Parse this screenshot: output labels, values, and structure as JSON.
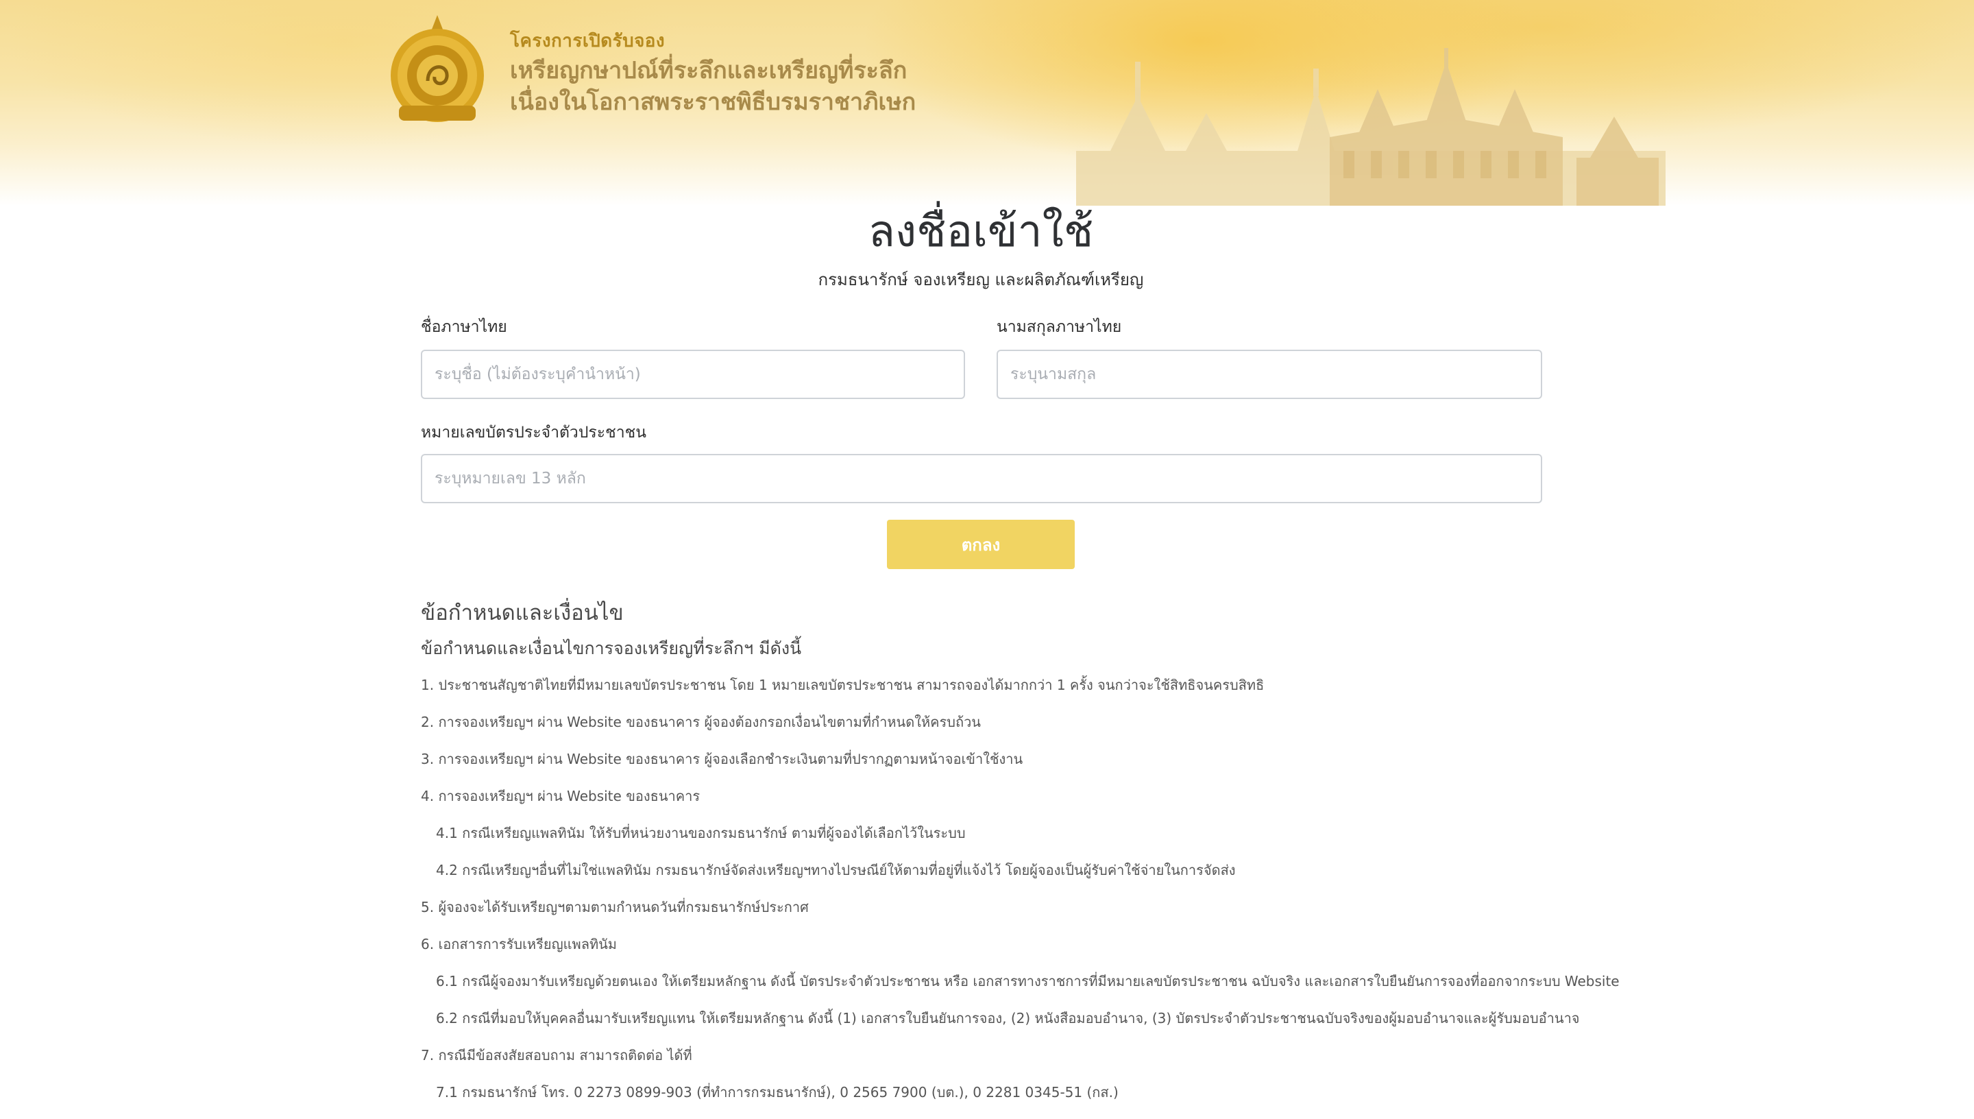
{
  "banner": {
    "kicker": "โครงการเปิดรับจอง",
    "line1": "เหรียญกษาปณ์ที่ระลึกและเหรียญที่ระลึก",
    "line2": "เนื่องในโอกาสพระราชพิธีบรมราชาภิเษก"
  },
  "header": {
    "title": "ลงชื่อเข้าใช้",
    "subtitle": "กรมธนารักษ์ จองเหรียญ และผลิตภัณฑ์เหรียญ"
  },
  "form": {
    "first_name_label": "ชื่อภาษาไทย",
    "first_name_placeholder": "ระบุชื่อ (ไม่ต้องระบุคำนำหน้า)",
    "last_name_label": "นามสกุลภาษาไทย",
    "last_name_placeholder": "ระบุนามสกุล",
    "id_label": "หมายเลขบัตรประจำตัวประชาชน",
    "id_placeholder": "ระบุหมายเลข 13 หลัก",
    "submit_label": "ตกลง"
  },
  "terms": {
    "heading": "ข้อกำหนดและเงื่อนไข",
    "intro": "ข้อกำหนดและเงื่อนไขการจองเหรียญที่ระลึกฯ มีดังนี้",
    "items": [
      "1. ประชาชนสัญชาติไทยที่มีหมายเลขบัตรประชาชน โดย 1 หมายเลขบัตรประชาชน สามารถจองได้มากกว่า 1 ครั้ง จนกว่าจะใช้สิทธิจนครบสิทธิ",
      "2. การจองเหรียญฯ ผ่าน Website ของธนาคาร ผู้จองต้องกรอกเงื่อนไขตามที่กำหนดให้ครบถ้วน",
      "3. การจองเหรียญฯ ผ่าน Website ของธนาคาร ผู้จองเลือกชำระเงินตามที่ปรากฏตามหน้าจอเข้าใช้งาน",
      "4. การจองเหรียญฯ ผ่าน Website ของธนาคาร",
      "4.1 กรณีเหรียญแพลทินัม ให้รับที่หน่วยงานของกรมธนารักษ์ ตามที่ผู้จองได้เลือกไว้ในระบบ",
      "4.2 กรณีเหรียญฯอื่นที่ไม่ใช่แพลทินัม กรมธนารักษ์จัดส่งเหรียญฯทางไปรษณีย์ให้ตามที่อยู่ที่แจ้งไว้ โดยผู้จองเป็นผู้รับค่าใช้จ่ายในการจัดส่ง",
      "5. ผู้จองจะได้รับเหรียญฯตามตามกำหนดวันที่กรมธนารักษ์ประกาศ",
      "6. เอกสารการรับเหรียญแพลทินัม",
      "6.1 กรณีผู้จองมารับเหรียญด้วยตนเอง ให้เตรียมหลักฐาน ดังนี้ บัตรประจำตัวประชาชน หรือ เอกสารทางราชการที่มีหมายเลขบัตรประชาชน ฉบับจริง และเอกสารใบยืนยันการจองที่ออกจากระบบ Website",
      "6.2 กรณีที่มอบให้บุคคลอื่นมารับเหรียญแทน ให้เตรียมหลักฐาน ดังนี้ (1) เอกสารใบยืนยันการจอง, (2) หนังสือมอบอำนาจ, (3) บัตรประจำตัวประชาชนฉบับจริงของผู้มอบอำนาจและผู้รับมอบอำนาจ",
      "7. กรณีมีข้อสงสัยสอบถาม สามารถติดต่อ ได้ที่",
      "7.1 กรมธนารักษ์ โทร. 0 2273 0899-903 (ที่ทำการกรมธนารักษ์), 0 2565 7900 (บต.), 0 2281 0345-51 (กส.)"
    ]
  },
  "colors": {
    "accent": "#f1d462",
    "banner_gold": "#f6d27a",
    "emblem_gold": "#d9a521"
  },
  "icons": {
    "emblem": "royal-mint-emblem-icon",
    "palace": "grand-palace-illustration"
  }
}
